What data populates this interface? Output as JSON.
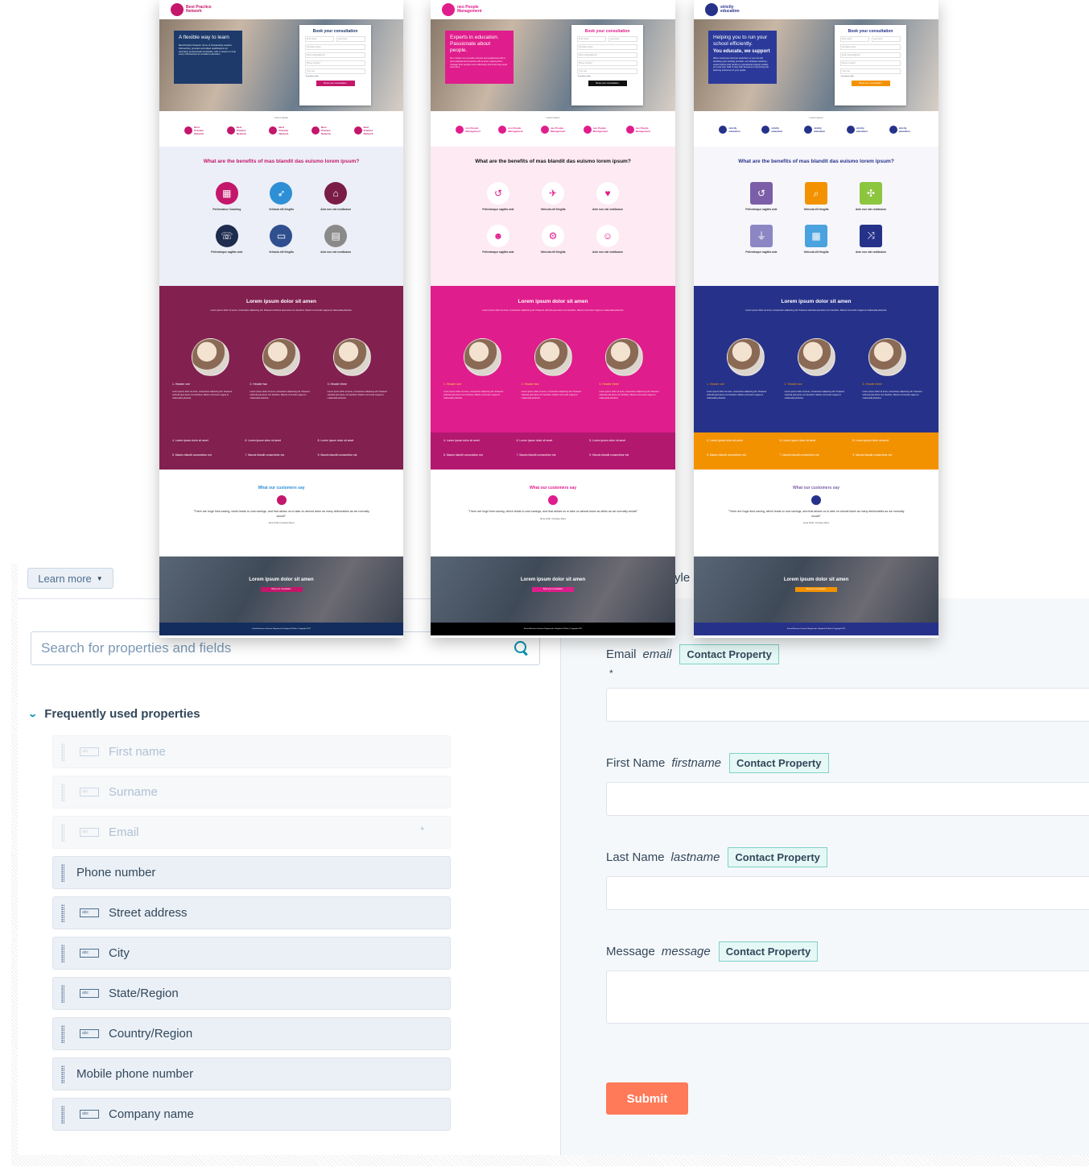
{
  "editor": {
    "learn_more_label": "Learn more",
    "style_tab_fragment": "yle",
    "search": {
      "placeholder": "Search for properties and fields",
      "value": ""
    },
    "section": {
      "title": "Frequently used properties",
      "expanded": true
    },
    "properties": [
      {
        "label": "First name",
        "icon": "abc",
        "disabled": true,
        "required": false
      },
      {
        "label": "Surname",
        "icon": "abc",
        "disabled": true,
        "required": false
      },
      {
        "label": "Email",
        "icon": "abc",
        "disabled": true,
        "required": true,
        "required_mark": "*"
      },
      {
        "label": "Phone number",
        "icon": null,
        "disabled": false,
        "required": false
      },
      {
        "label": "Street address",
        "icon": "abc",
        "disabled": false,
        "required": false
      },
      {
        "label": "City",
        "icon": "abc",
        "disabled": false,
        "required": false
      },
      {
        "label": "State/Region",
        "icon": "abc",
        "disabled": false,
        "required": false
      },
      {
        "label": "Country/Region",
        "icon": "abc",
        "disabled": false,
        "required": false
      },
      {
        "label": "Mobile phone number",
        "icon": null,
        "disabled": false,
        "required": false
      },
      {
        "label": "Company name",
        "icon": "abc",
        "disabled": false,
        "required": false
      }
    ],
    "form": {
      "fields": [
        {
          "label": "Email",
          "internal_name": "email",
          "badge": "Contact Property",
          "required_mark": "*",
          "value": ""
        },
        {
          "label": "First Name",
          "internal_name": "firstname",
          "badge": "Contact Property",
          "value": ""
        },
        {
          "label": "Last Name",
          "internal_name": "lastname",
          "badge": "Contact Property",
          "value": ""
        },
        {
          "label": "Message",
          "internal_name": "message",
          "badge": "Contact Property",
          "value": ""
        }
      ],
      "submit_label": "Submit",
      "submit_color": "#ff7a59"
    },
    "colors": {
      "accent": "#0091ae",
      "badge_border": "#7fd1c7",
      "badge_bg": "#e5f8f6"
    }
  },
  "mockups": [
    {
      "brand": "Best Practice Network",
      "primary": "#c4166b",
      "hero_box_color": "#1d3a6b",
      "hero_title": "A flexible way to learn",
      "hero_text": "Best Practice Network, home of Outstanding Leaders Partnership, provides accredited qualifications for education professionals worldwide, with a mission to help every child access an excellent education.",
      "form_title": "Book your consultation",
      "form_title_color": "#1d3a6b",
      "form_fields": [
        "First name*",
        "Last name",
        "Company name",
        "Work email address*",
        "Phone number*",
        "Your role"
      ],
      "form_note": "*mandatory fields",
      "form_button": "Book your consultation",
      "form_button_color": "#c4166b",
      "logos_caption": "Lorem ipsum",
      "benefits_title": "What are the benefits of mas blandit das euismo lorem ipsum?",
      "benefits_title_color": "#c4166b",
      "benefits_bg": "#eceff7",
      "benefits": [
        {
          "label": "Performance Coaching",
          "icon": "calendar-icon",
          "color": "#c4166b"
        },
        {
          "label": "Vehicula elit fringilla",
          "icon": "compass-icon",
          "color": "#2e8fd6"
        },
        {
          "label": "Ante non nisi vestibulum",
          "icon": "building-icon",
          "color": "#7a1c48"
        },
        {
          "label": "Pellentesque sagittis ante",
          "icon": "speech-icon",
          "color": "#1d2b4f"
        },
        {
          "label": "Vehicula elit fringilla",
          "icon": "monitor-icon",
          "color": "#2f4f8f"
        },
        {
          "label": "Ante non nisi vestibulum",
          "icon": "document-icon",
          "color": "#8a8a8a"
        }
      ],
      "feature_bg": "#822050",
      "feature_bottom_bg": "#822050",
      "feature_title": "Lorem ipsum dolor sit amen",
      "feature_text": "Lorem ipsum dolor sit amet, consectetur adipiscing elit. Praesent vehicula quis lacus non faucibus. Mauris commodo magna et malesuada pharetra.",
      "feature_headers": [
        "1. Header one",
        "2. Header two",
        "3. Header three"
      ],
      "feature_header_color": "#ffffff",
      "feature_col_text": "Lorem ipsum dolor sit amet, consectetur adipiscing elit. Praesent vehicula quis lacus non faucibus. Mauris commodo magna et malesuada pharetra.",
      "feature_list": [
        "4. Lorem ipsum dolor sit amet",
        "6. Lorem ipsum dolor sit amet",
        "8. Lorem ipsum dolor sit amet",
        "5. Mauris blandit consectetur est",
        "7. Mauris blandit consectetur est",
        "9. Mauris blandit consectetur est"
      ],
      "testimonial_title": "What our customers say",
      "testimonial_title_color": "#2e8fd6",
      "quote": "\"There are huge time-saving, which leads to cost savings, and that allows us to take on almost twice as many deliverables as we normally would!\"",
      "author": "Jamie Smith | Company Name",
      "cta_title": "Lorem ipsum dolor sit amen",
      "cta_button": "Book your consultation",
      "cta_button_color": "#c4166b",
      "footer_text": "School Business Services Registered in England & Wales | Copyright 2021",
      "footer_bg": "#132d5e"
    },
    {
      "brand": "neo People Management",
      "primary": "#e01d8c",
      "hero_box_color": "#e01d8c",
      "hero_title": "Experts in education. Passionate about people.",
      "hero_text": "Our mission is to provide schools and academies with a personalised and proactive HR service, helping them manage their people more effectively and improving pupil outcomes.",
      "form_title": "Book your consultation",
      "form_title_color": "#e01d8c",
      "form_fields": [
        "First name*",
        "Last name",
        "Company name",
        "Work email address*",
        "Phone number*",
        "Your role"
      ],
      "form_note": "*mandatory fields",
      "form_button": "Book your consultation",
      "form_button_color": "#111111",
      "logos_caption": "Lorem ipsum",
      "benefits_title": "What are the benefits of mas blandit das euismo lorem ipsum?",
      "benefits_title_color": "#111111",
      "benefits_bg": "#fdeaf3",
      "benefits": [
        {
          "label": "Pellentesque sagittis ante",
          "icon": "history-icon",
          "color": "#ffffff",
          "glyph_color": "#e01d8c"
        },
        {
          "label": "Vehicula elit fringilla",
          "icon": "airplane-icon",
          "color": "#ffffff",
          "glyph_color": "#e01d8c"
        },
        {
          "label": "Ante non nisi vestibulum",
          "icon": "heart-pulse-icon",
          "color": "#ffffff",
          "glyph_color": "#e01d8c"
        },
        {
          "label": "Pellentesque sagittis ante",
          "icon": "group-icon",
          "color": "#ffffff",
          "glyph_color": "#e01d8c"
        },
        {
          "label": "Vehicula elit fringilla",
          "icon": "bicycle-icon",
          "color": "#ffffff",
          "glyph_color": "#e01d8c"
        },
        {
          "label": "Ante non nisi vestibulum",
          "icon": "smiley-icon",
          "color": "#ffffff",
          "glyph_color": "#e01d8c"
        }
      ],
      "feature_bg": "#e01d8c",
      "feature_bottom_bg": "#b3186f",
      "feature_title": "Lorem ipsum dolor sit amen",
      "feature_text": "Lorem ipsum dolor sit amet, consectetur adipiscing elit. Praesent vehicula quis lacus non faucibus. Mauris commodo magna et malesuada pharetra.",
      "feature_headers": [
        "1. Header one",
        "2. Header two",
        "3. Header three"
      ],
      "feature_header_color": "#ffd23f",
      "feature_col_text": "Lorem ipsum dolor sit amet, consectetur adipiscing elit. Praesent vehicula quis lacus non faucibus. Mauris commodo magna et malesuada pharetra.",
      "feature_list": [
        "4. Lorem ipsum dolor sit amet",
        "6. Lorem ipsum dolor sit amet",
        "8. Lorem ipsum dolor sit amet",
        "5. Mauris blandit consectetur est",
        "7. Mauris blandit consectetur est",
        "9. Mauris blandit consectetur est"
      ],
      "testimonial_title": "What our customers say",
      "testimonial_title_color": "#e01d8c",
      "quote": "\"There are huge time-saving, which leads to cost savings, and that allows us to take on almost twice as ables as we normally would!\"",
      "author": "Jamie Smith | Company Name",
      "cta_title": "Lorem ipsum dolor sit amen",
      "cta_button": "Book your consultation",
      "cta_button_color": "#e01d8c",
      "footer_text": "School Business Services Registered in England & Wales | Copyright 2021",
      "footer_bg": "#000000"
    },
    {
      "brand": "strictly education",
      "primary": "#26328a",
      "hero_box_color": "#2b3a9a",
      "hero_title": "Helping you to run your school efficiently.",
      "hero_subtitle": "You educate, we support",
      "hero_text": "When resources become stretched, or you are left doubting your existing provider, our strategic solutions, expert advice and hands-on operational support enable you and your staff to stay fully focused on improving the learning outcomes of your pupils.",
      "form_title": "Book your consultation",
      "form_title_color": "#26328a",
      "form_fields": [
        "First name*",
        "Last name",
        "Company name",
        "Work email address*",
        "Phone number*",
        "Your role"
      ],
      "form_note": "*mandatory fields",
      "form_button": "Book your consultation",
      "form_button_color": "#f39200",
      "logos_caption": "Lorem ipsum",
      "benefits_title": "What are the benefits of mas blandit das euismo lorem ipsum?",
      "benefits_title_color": "#26328a",
      "benefits_bg": "#f6f6fb",
      "benefits": [
        {
          "label": "Pellentesque sagittis ante",
          "icon": "history-icon",
          "color": "#7b5ea7"
        },
        {
          "label": "Vehicula elit fringilla",
          "icon": "search-icon",
          "color": "#f39200"
        },
        {
          "label": "Ante non nisi vestibulum",
          "icon": "network-icon",
          "color": "#8cc63f"
        },
        {
          "label": "Pellentesque sagittis ante",
          "icon": "plug-icon",
          "color": "#8c86c4"
        },
        {
          "label": "Vehicula elit fringilla",
          "icon": "calendar-icon",
          "color": "#4aa3df"
        },
        {
          "label": "Ante non nisi vestibulum",
          "icon": "shuffle-icon",
          "color": "#26328a"
        }
      ],
      "feature_bg": "#26328a",
      "feature_bottom_bg": "#f39200",
      "feature_title": "Lorem ipsum dolor sit amen",
      "feature_text": "Lorem ipsum dolor sit amet, consectetur adipiscing elit. Praesent vehicula quis lacus non faucibus. Mauris commodo magna et malesuada pharetra.",
      "feature_headers": [
        "1. Header one",
        "2. Header two",
        "3. Header three"
      ],
      "feature_header_color": "#f39200",
      "feature_col_text": "Lorem ipsum dolor sit amet, consectetur adipiscing elit. Praesent vehicula quis lacus non faucibus. Mauris commodo magna et malesuada pharetra.",
      "feature_list": [
        "4. Lorem ipsum dolor sit amet",
        "6. Lorem ipsum dolor sit amet",
        "8. Lorem ipsum dolor sit amet",
        "5. Mauris blandit consectetur est",
        "7. Mauris blandit consectetur est",
        "9. Mauris blandit consectetur est"
      ],
      "testimonial_title": "What our customers say",
      "testimonial_title_color": "#7b5ea7",
      "quote": "\"There are huge time-saving, which leads to cost savings, and that allows us to take on almost twice as many deliverables as we normally would!\"",
      "author": "Jamie Smith | Company Name",
      "cta_title": "Lorem ipsum dolor sit amen",
      "cta_button": "Book your consultation",
      "cta_button_color": "#f39200",
      "footer_text": "School Business Services Registered in England & Wales | Copyright 2021",
      "footer_bg": "#26328a"
    }
  ]
}
